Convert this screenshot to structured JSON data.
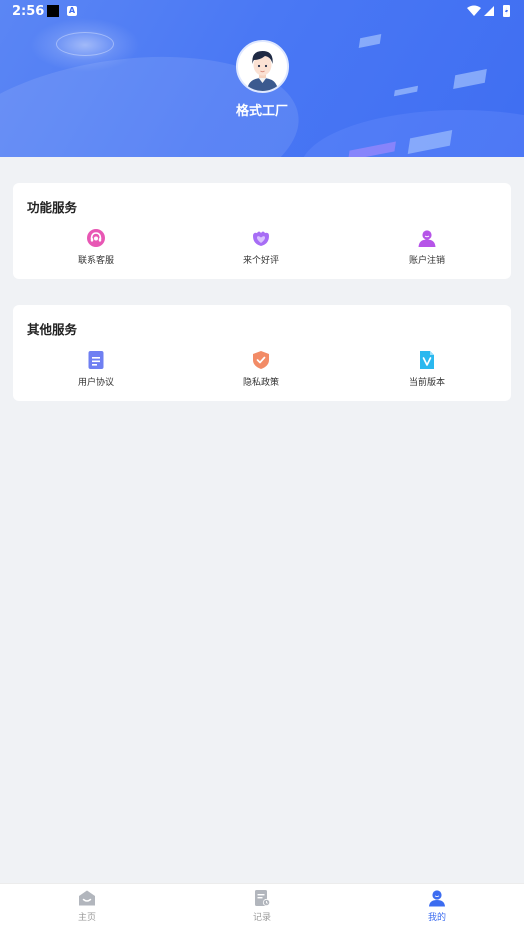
{
  "status_bar": {
    "time": "2:56",
    "notification_badge": "A"
  },
  "profile": {
    "username": "格式工厂"
  },
  "sections": [
    {
      "title": "功能服务",
      "items": [
        {
          "label": "联系客服",
          "icon": "headset-icon",
          "color": "#e857b4"
        },
        {
          "label": "来个好评",
          "icon": "heart-flower-icon",
          "color": "#a76df5"
        },
        {
          "label": "账户注销",
          "icon": "user-icon",
          "color": "#b654e8"
        }
      ]
    },
    {
      "title": "其他服务",
      "items": [
        {
          "label": "用户协议",
          "icon": "document-icon",
          "color": "#6f7ff2"
        },
        {
          "label": "隐私政策",
          "icon": "shield-icon",
          "color": "#f28b66"
        },
        {
          "label": "当前版本",
          "icon": "version-icon",
          "color": "#2bb8ef"
        }
      ]
    }
  ],
  "tabbar": {
    "tabs": [
      {
        "label": "主页",
        "icon": "home-icon",
        "active": false
      },
      {
        "label": "记录",
        "icon": "record-icon",
        "active": false
      },
      {
        "label": "我的",
        "icon": "profile-icon",
        "active": true
      }
    ],
    "active_color": "#3c6cf0",
    "inactive_color": "#9a9a9a"
  },
  "colors": {
    "header_blue": "#4a78f4",
    "background": "#f0f2f5"
  }
}
